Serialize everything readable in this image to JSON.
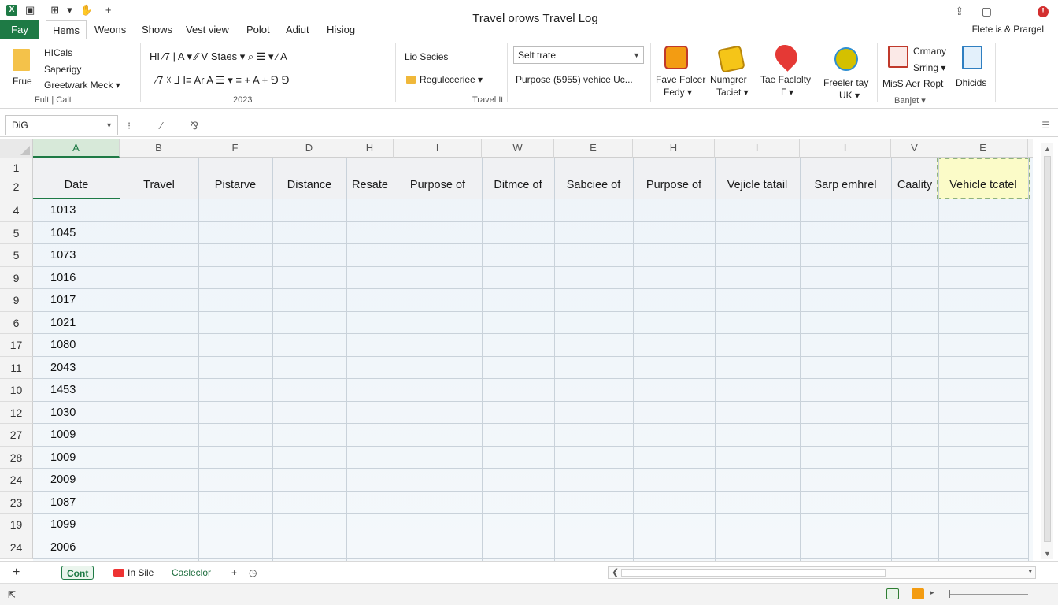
{
  "app": {
    "window_title": "Travel orows Travel Log",
    "qat_icons": [
      "excel-app-icon",
      "save-icon",
      "undo-icon",
      "redo-icon",
      "paint-icon",
      "add-icon"
    ]
  },
  "window_controls": {
    "share": "⇪",
    "restore": "▢",
    "minimize": "—",
    "close": "!"
  },
  "tabs": {
    "file": "Fay",
    "items": [
      "Hems",
      "Weons",
      "Shows",
      "Vest view",
      "Polot",
      "Adiut",
      "Hisiog"
    ],
    "right": "Flete iε & Prargel"
  },
  "ribbon": {
    "clipboard": {
      "paste": "Frue",
      "item1": "HICals",
      "item2": "Saperigy",
      "item3": "Greetwark Meck ▾",
      "group": "Fult | Calt"
    },
    "font": {
      "row1": "HI  ⁄7  |  A ▾  ⁄⁄  V   Staes ▾   ⌕ ☰ ▾  ⁄  A",
      "row2": "⁄7  ☓   ⅃  I≡ Ar   A  ☰ ▾   ≡ +  A  + ⅁  ⅁",
      "group": "2023"
    },
    "series": {
      "label": "Lio Secies",
      "field": "Reguleceriee ▾",
      "group": "Travel It"
    },
    "dropdown": {
      "value": "Selt trate",
      "purpose_line": "Purpose (5955) vehice Uc..."
    },
    "commands": [
      {
        "label1": "Fave Folcer",
        "label2": "Fedy ▾"
      },
      {
        "label1": "Numgrer",
        "label2": "Taciet ▾"
      },
      {
        "label1": "Tae Faclolty",
        "label2": "Γ ▾"
      },
      {
        "label1": "Freeler tay",
        "label2": "UK ▾"
      }
    ],
    "right": {
      "item1": "Crmany",
      "item2": "Srring ▾",
      "item3": "MisS Aer",
      "item4": "Ropt",
      "group": "Banjet ▾",
      "last": "Dhicids"
    }
  },
  "formula": {
    "namebox": "DiG",
    "fx1": "⁝",
    "fx2": "⁄",
    "fx3": "⅋",
    "value": ""
  },
  "grid": {
    "column_letters": [
      "A",
      "B",
      "F",
      "D",
      "H",
      "I",
      "W",
      "E",
      "H",
      "I",
      "I",
      "V",
      "E"
    ],
    "header_row_numbers": [
      "1",
      "2"
    ],
    "headers": [
      "Date",
      "Travel",
      "Pistarve",
      "Distance",
      "Resate",
      "Purpose of",
      "Ditmce of",
      "Sabciee of",
      "Purpose of",
      "Vejicle tatail",
      "Sarp emhrel",
      "Caality",
      "Vehicle tcatel"
    ],
    "row_numbers": [
      "4",
      "5",
      "5",
      "9",
      "9",
      "6",
      "17",
      "11",
      "10",
      "12",
      "27",
      "28",
      "24",
      "23",
      "19",
      "24"
    ],
    "dates": [
      "1013",
      "1045",
      "1073",
      "1016",
      "1017",
      "1021",
      "1080",
      "2043",
      "1453",
      "1030",
      "1009",
      "1009",
      "2009",
      "1087",
      "1099",
      "2006"
    ]
  },
  "sheets": {
    "add": "+",
    "tabs": [
      "Cont",
      "In Sile",
      "Casleclor"
    ],
    "more": "+",
    "history": "◷"
  },
  "status": {
    "left": "⇱",
    "zoom": ""
  }
}
